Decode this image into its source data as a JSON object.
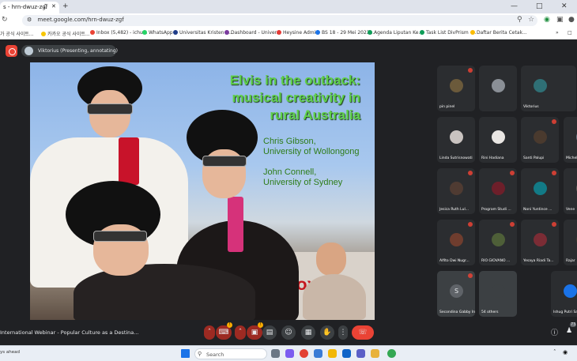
{
  "browser": {
    "tab_title": "s - hrn-dwuz-zgf",
    "new_tab": "+",
    "url": "meet.google.com/hrn-dwuz-zgf",
    "bookmarks": [
      "가 공식 사이트...",
      "카카오 공식 사이트...",
      "Inbox (5,482) - ichu...",
      "WhatsApp",
      "Universitas Kristen S...",
      "Dashboard - Univer...",
      "Heysine Admin",
      "BS 18 - 29 Mei 2023...",
      "Agenda Liputan Ke...",
      "Task List DivPrism -...",
      "Daftar Berita Cetak..."
    ],
    "bookmark_more": "»"
  },
  "meet": {
    "presenter_label": "Viktorius (Presenting, annotating)",
    "slide": {
      "title_lines": [
        "Elvis in the outback:",
        "musical creativity in",
        "rural Australia"
      ],
      "authors": [
        {
          "name": "Chris Gibson,",
          "affiliation": "University of Wollongong"
        },
        {
          "name": "John Connell,",
          "affiliation": "University of Sydney"
        }
      ],
      "sign_text": "TOYOTA"
    },
    "participants": [
      {
        "name": "pin pinel",
        "color": "#6b5a3b",
        "muted": true
      },
      {
        "name": "",
        "color": "#8a8f96",
        "muted": false
      },
      {
        "name": "Viktorius",
        "color": "#2f6f75",
        "muted": false
      },
      {
        "name": "Linda Sutrisnowati",
        "color": "#c9c3c0",
        "muted": false
      },
      {
        "name": "Rini Hadiana",
        "color": "#e9e6e3",
        "muted": false
      },
      {
        "name": "Santi Palupi",
        "color": "#4a3a2e",
        "muted": true
      },
      {
        "name": "Michel",
        "color": "#6a7582",
        "muted": false
      },
      {
        "name": "Jesica Ruth Lul...",
        "color": "#4f3b32",
        "muted": true
      },
      {
        "name": "Program Studi ...",
        "color": "#6d1f2a",
        "muted": true
      },
      {
        "name": "Noni Yuntince ...",
        "color": "#127a86",
        "muted": true
      },
      {
        "name": "Vene",
        "color": "#5d5a53",
        "muted": false
      },
      {
        "name": "Alfito Dwi Nugr...",
        "color": "#6f3d2e",
        "muted": true
      },
      {
        "name": "RIO GIOVANO ...",
        "color": "#4e5f38",
        "muted": true
      },
      {
        "name": "Yesaya Riadi Ta...",
        "color": "#7b2c35",
        "muted": true
      },
      {
        "name": "Rajar",
        "color": "#3d3a2d",
        "muted": false
      },
      {
        "name": "Secondina Gabby Intan ...",
        "color": "#3c4043",
        "muted": true,
        "initial": "S"
      },
      {
        "name": "54 others",
        "color": "#3c4043",
        "muted": false
      },
      {
        "name": "Ishug Putri Sal",
        "color": "#1a73e8",
        "muted": false
      }
    ],
    "meeting_title": "International Webinar - Popular Culture as a Destina...",
    "participant_count": "73",
    "controls": {
      "mic_badge": "!",
      "cam_badge": "!"
    }
  },
  "taskbar": {
    "status": "ys ahead",
    "search_placeholder": "Search",
    "tray_time": ""
  }
}
